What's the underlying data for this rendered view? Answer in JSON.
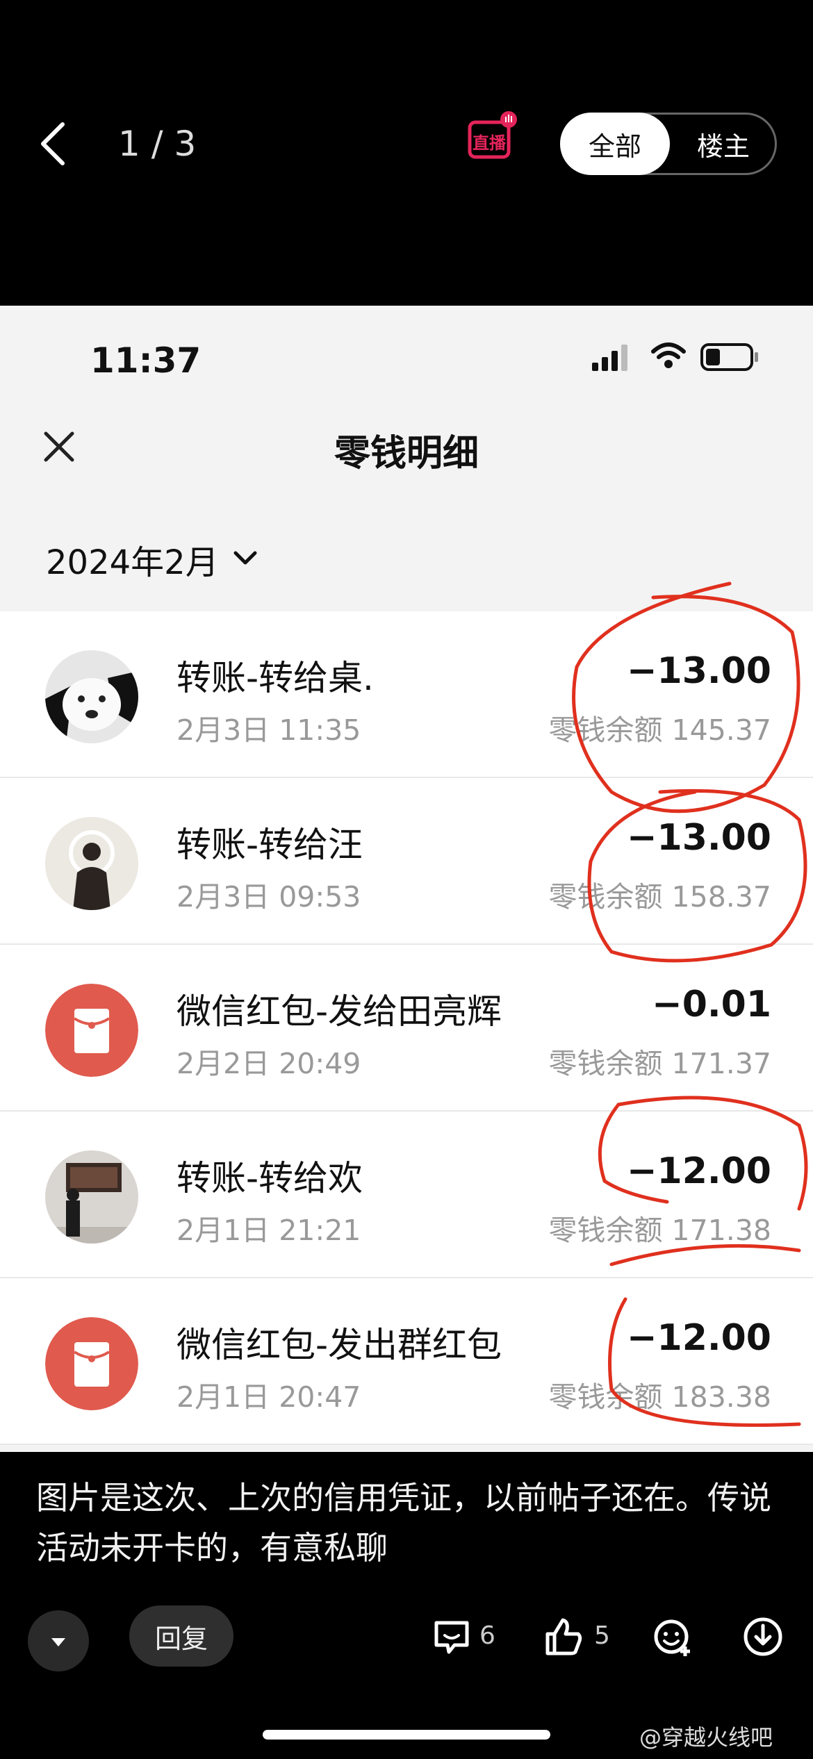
{
  "viewer": {
    "counter": "1 / 3",
    "live_label": "直播",
    "filter_all": "全部",
    "filter_op": "楼主"
  },
  "screenshot": {
    "status_time": "11:37",
    "title": "零钱明细",
    "month": "2024年2月",
    "transactions": [
      {
        "name": "转账-转给桌.",
        "date": "2月3日 11:35",
        "amount": "−13.00",
        "balance": "零钱余额 145.37",
        "avatar": "dog-avatar"
      },
      {
        "name": "转账-转给汪",
        "date": "2月3日 09:53",
        "amount": "−13.00",
        "balance": "零钱余额 158.37",
        "avatar": "person-avatar"
      },
      {
        "name": "微信红包-发给田亮辉",
        "date": "2月2日 20:49",
        "amount": "−0.01",
        "balance": "零钱余额 171.37",
        "avatar": "red-envelope-icon"
      },
      {
        "name": "转账-转给欢",
        "date": "2月1日 21:21",
        "amount": "−12.00",
        "balance": "零钱余额 171.38",
        "avatar": "gallery-avatar"
      },
      {
        "name": "微信红包-发出群红包",
        "date": "2月1日 20:47",
        "amount": "−12.00",
        "balance": "零钱余额 183.38",
        "avatar": "red-envelope-icon"
      }
    ]
  },
  "caption": "图片是这次、上次的信用凭证，以前帖子还在。传说活动未开卡的，有意私聊",
  "bottom_bar": {
    "reply_label": "回复",
    "comment_count": "6",
    "like_count": "5"
  },
  "watermark": "@穿越火线吧",
  "colors": {
    "accent_red": "#e05a4e",
    "scribble": "#e0301e"
  }
}
